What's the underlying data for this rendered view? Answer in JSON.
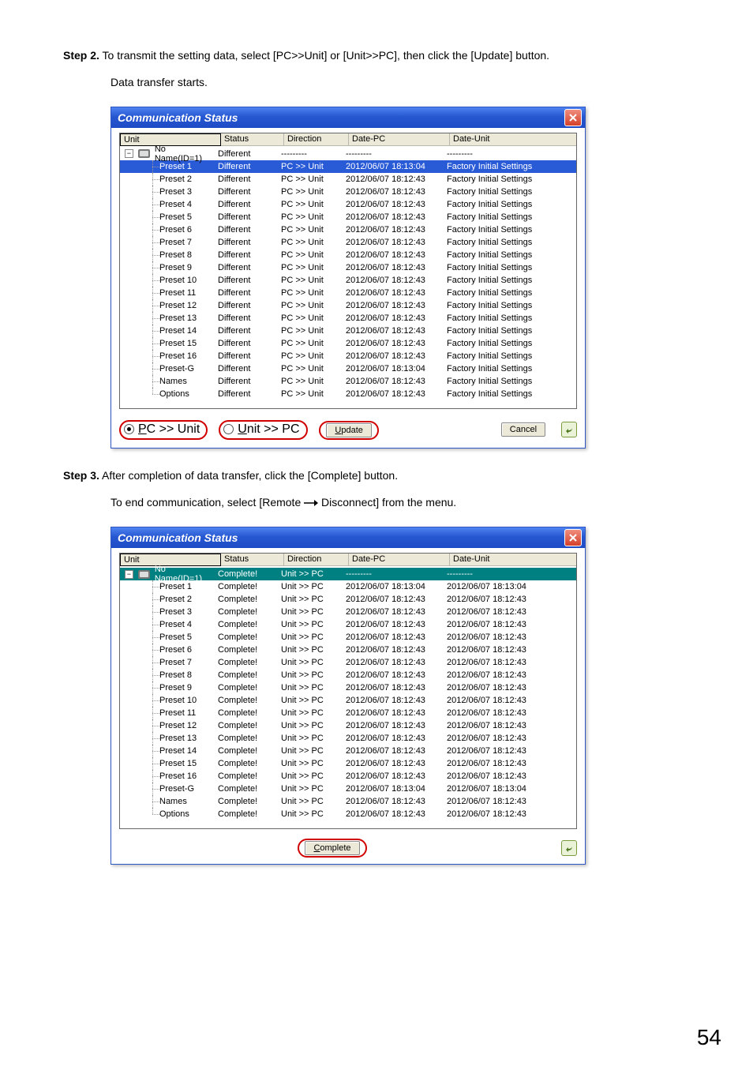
{
  "steps": {
    "step2": {
      "label": "Step 2.",
      "text": "To transmit the setting data, select [PC>>Unit] or [Unit>>PC], then click the [Update] button.",
      "text2": "Data transfer starts."
    },
    "step3": {
      "label": "Step 3.",
      "text": "After completion of data transfer, click the [Complete] button.",
      "text2a": "To end communication, select [Remote ",
      "text2b": " Disconnect] from the menu."
    }
  },
  "columns": {
    "unit": "Unit",
    "status": "Status",
    "direction": "Direction",
    "date_pc": "Date-PC",
    "date_unit": "Date-Unit"
  },
  "table1": {
    "title": "Communication Status",
    "root": {
      "unit": "No Name(ID=1)",
      "status": "Different",
      "direction": "---------",
      "date_pc": "---------",
      "date_unit": "---------"
    },
    "rows": [
      {
        "unit": "Preset 1",
        "status": "Different",
        "direction": "PC >> Unit",
        "date_pc": "2012/06/07 18:13:04",
        "date_unit": "Factory Initial Settings",
        "selected": true
      },
      {
        "unit": "Preset 2",
        "status": "Different",
        "direction": "PC >> Unit",
        "date_pc": "2012/06/07 18:12:43",
        "date_unit": "Factory Initial Settings"
      },
      {
        "unit": "Preset 3",
        "status": "Different",
        "direction": "PC >> Unit",
        "date_pc": "2012/06/07 18:12:43",
        "date_unit": "Factory Initial Settings"
      },
      {
        "unit": "Preset 4",
        "status": "Different",
        "direction": "PC >> Unit",
        "date_pc": "2012/06/07 18:12:43",
        "date_unit": "Factory Initial Settings"
      },
      {
        "unit": "Preset 5",
        "status": "Different",
        "direction": "PC >> Unit",
        "date_pc": "2012/06/07 18:12:43",
        "date_unit": "Factory Initial Settings"
      },
      {
        "unit": "Preset 6",
        "status": "Different",
        "direction": "PC >> Unit",
        "date_pc": "2012/06/07 18:12:43",
        "date_unit": "Factory Initial Settings"
      },
      {
        "unit": "Preset 7",
        "status": "Different",
        "direction": "PC >> Unit",
        "date_pc": "2012/06/07 18:12:43",
        "date_unit": "Factory Initial Settings"
      },
      {
        "unit": "Preset 8",
        "status": "Different",
        "direction": "PC >> Unit",
        "date_pc": "2012/06/07 18:12:43",
        "date_unit": "Factory Initial Settings"
      },
      {
        "unit": "Preset 9",
        "status": "Different",
        "direction": "PC >> Unit",
        "date_pc": "2012/06/07 18:12:43",
        "date_unit": "Factory Initial Settings"
      },
      {
        "unit": "Preset 10",
        "status": "Different",
        "direction": "PC >> Unit",
        "date_pc": "2012/06/07 18:12:43",
        "date_unit": "Factory Initial Settings"
      },
      {
        "unit": "Preset 11",
        "status": "Different",
        "direction": "PC >> Unit",
        "date_pc": "2012/06/07 18:12:43",
        "date_unit": "Factory Initial Settings"
      },
      {
        "unit": "Preset 12",
        "status": "Different",
        "direction": "PC >> Unit",
        "date_pc": "2012/06/07 18:12:43",
        "date_unit": "Factory Initial Settings"
      },
      {
        "unit": "Preset 13",
        "status": "Different",
        "direction": "PC >> Unit",
        "date_pc": "2012/06/07 18:12:43",
        "date_unit": "Factory Initial Settings"
      },
      {
        "unit": "Preset 14",
        "status": "Different",
        "direction": "PC >> Unit",
        "date_pc": "2012/06/07 18:12:43",
        "date_unit": "Factory Initial Settings"
      },
      {
        "unit": "Preset 15",
        "status": "Different",
        "direction": "PC >> Unit",
        "date_pc": "2012/06/07 18:12:43",
        "date_unit": "Factory Initial Settings"
      },
      {
        "unit": "Preset 16",
        "status": "Different",
        "direction": "PC >> Unit",
        "date_pc": "2012/06/07 18:12:43",
        "date_unit": "Factory Initial Settings"
      },
      {
        "unit": "Preset-G",
        "status": "Different",
        "direction": "PC >> Unit",
        "date_pc": "2012/06/07 18:13:04",
        "date_unit": "Factory Initial Settings"
      },
      {
        "unit": "Names",
        "status": "Different",
        "direction": "PC >> Unit",
        "date_pc": "2012/06/07 18:12:43",
        "date_unit": "Factory Initial Settings"
      },
      {
        "unit": "Options",
        "status": "Different",
        "direction": "PC >> Unit",
        "date_pc": "2012/06/07 18:12:43",
        "date_unit": "Factory Initial Settings"
      }
    ],
    "radio1_prefix": "P",
    "radio1_suffix": "C >> Unit",
    "radio2_prefix": "U",
    "radio2_suffix": "nit >> PC",
    "update_prefix": "U",
    "update_suffix": "pdate",
    "cancel": "Cancel"
  },
  "table2": {
    "title": "Communication Status",
    "root": {
      "unit": "No Name(ID=1)",
      "status": "Complete!",
      "direction": "Unit >> PC",
      "date_pc": "---------",
      "date_unit": "---------",
      "selected": true
    },
    "rows": [
      {
        "unit": "Preset 1",
        "status": "Complete!",
        "direction": "Unit >> PC",
        "date_pc": "2012/06/07 18:13:04",
        "date_unit": "2012/06/07 18:13:04"
      },
      {
        "unit": "Preset 2",
        "status": "Complete!",
        "direction": "Unit >> PC",
        "date_pc": "2012/06/07 18:12:43",
        "date_unit": "2012/06/07 18:12:43"
      },
      {
        "unit": "Preset 3",
        "status": "Complete!",
        "direction": "Unit >> PC",
        "date_pc": "2012/06/07 18:12:43",
        "date_unit": "2012/06/07 18:12:43"
      },
      {
        "unit": "Preset 4",
        "status": "Complete!",
        "direction": "Unit >> PC",
        "date_pc": "2012/06/07 18:12:43",
        "date_unit": "2012/06/07 18:12:43"
      },
      {
        "unit": "Preset 5",
        "status": "Complete!",
        "direction": "Unit >> PC",
        "date_pc": "2012/06/07 18:12:43",
        "date_unit": "2012/06/07 18:12:43"
      },
      {
        "unit": "Preset 6",
        "status": "Complete!",
        "direction": "Unit >> PC",
        "date_pc": "2012/06/07 18:12:43",
        "date_unit": "2012/06/07 18:12:43"
      },
      {
        "unit": "Preset 7",
        "status": "Complete!",
        "direction": "Unit >> PC",
        "date_pc": "2012/06/07 18:12:43",
        "date_unit": "2012/06/07 18:12:43"
      },
      {
        "unit": "Preset 8",
        "status": "Complete!",
        "direction": "Unit >> PC",
        "date_pc": "2012/06/07 18:12:43",
        "date_unit": "2012/06/07 18:12:43"
      },
      {
        "unit": "Preset 9",
        "status": "Complete!",
        "direction": "Unit >> PC",
        "date_pc": "2012/06/07 18:12:43",
        "date_unit": "2012/06/07 18:12:43"
      },
      {
        "unit": "Preset 10",
        "status": "Complete!",
        "direction": "Unit >> PC",
        "date_pc": "2012/06/07 18:12:43",
        "date_unit": "2012/06/07 18:12:43"
      },
      {
        "unit": "Preset 11",
        "status": "Complete!",
        "direction": "Unit >> PC",
        "date_pc": "2012/06/07 18:12:43",
        "date_unit": "2012/06/07 18:12:43"
      },
      {
        "unit": "Preset 12",
        "status": "Complete!",
        "direction": "Unit >> PC",
        "date_pc": "2012/06/07 18:12:43",
        "date_unit": "2012/06/07 18:12:43"
      },
      {
        "unit": "Preset 13",
        "status": "Complete!",
        "direction": "Unit >> PC",
        "date_pc": "2012/06/07 18:12:43",
        "date_unit": "2012/06/07 18:12:43"
      },
      {
        "unit": "Preset 14",
        "status": "Complete!",
        "direction": "Unit >> PC",
        "date_pc": "2012/06/07 18:12:43",
        "date_unit": "2012/06/07 18:12:43"
      },
      {
        "unit": "Preset 15",
        "status": "Complete!",
        "direction": "Unit >> PC",
        "date_pc": "2012/06/07 18:12:43",
        "date_unit": "2012/06/07 18:12:43"
      },
      {
        "unit": "Preset 16",
        "status": "Complete!",
        "direction": "Unit >> PC",
        "date_pc": "2012/06/07 18:12:43",
        "date_unit": "2012/06/07 18:12:43"
      },
      {
        "unit": "Preset-G",
        "status": "Complete!",
        "direction": "Unit >> PC",
        "date_pc": "2012/06/07 18:13:04",
        "date_unit": "2012/06/07 18:13:04"
      },
      {
        "unit": "Names",
        "status": "Complete!",
        "direction": "Unit >> PC",
        "date_pc": "2012/06/07 18:12:43",
        "date_unit": "2012/06/07 18:12:43"
      },
      {
        "unit": "Options",
        "status": "Complete!",
        "direction": "Unit >> PC",
        "date_pc": "2012/06/07 18:12:43",
        "date_unit": "2012/06/07 18:12:43"
      }
    ],
    "complete_prefix": "C",
    "complete_suffix": "omplete"
  },
  "page_number": "54"
}
